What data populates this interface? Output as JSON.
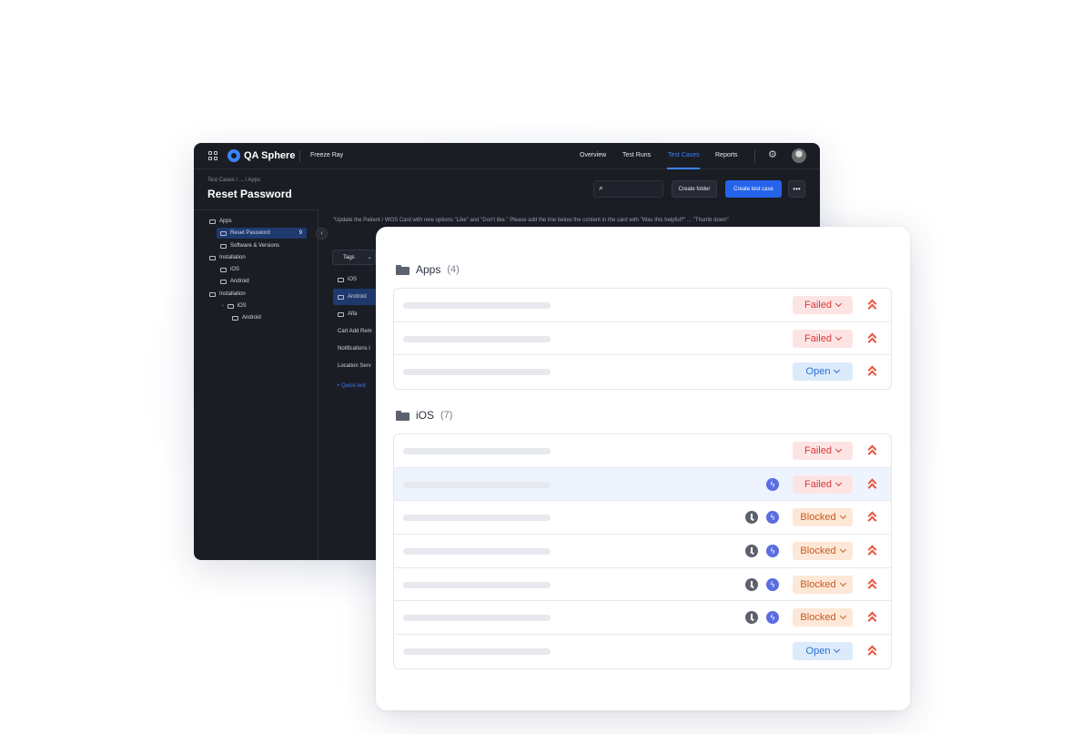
{
  "app": {
    "logo_text": "QA Sphere",
    "project": "Freeze Ray",
    "nav": [
      "Overview",
      "Test Runs",
      "Test Cases",
      "Reports"
    ],
    "active_nav": "Test Cases",
    "accent": "#3b82f6"
  },
  "header": {
    "breadcrumb": "Test Cases   /   ...   /   Apps",
    "title": "Reset Password",
    "search_placeholder": "",
    "create_folder": "Create folder",
    "create_test_case": "Create test case",
    "more": "•••"
  },
  "tree": {
    "items": [
      {
        "label": "Apps"
      },
      {
        "label": "Reset Password",
        "count": "9"
      },
      {
        "label": "Software & Versions"
      },
      {
        "label": "Installation"
      },
      {
        "label": "iOS"
      },
      {
        "label": "Android"
      },
      {
        "label": "Installation"
      },
      {
        "label": "iOS"
      },
      {
        "label": "Android"
      }
    ]
  },
  "middle": {
    "notice": "\"Update the Patient / WOS Card with new options \"Like\" and \"Don't like.\" Please add the line below the content in the card with \"Was this helpful?\" ... \"Thumb down\"",
    "tags_label": "Tags",
    "items": [
      "iOS",
      "Android",
      "Alfa",
      "Cart Add Rem",
      "Notifications l",
      "Location Serv"
    ],
    "quick_add": "+  Quick test"
  },
  "groups": [
    {
      "name": "Apps",
      "count": "(4)",
      "rows": [
        {
          "status": "Failed",
          "kind": "failed",
          "icons": []
        },
        {
          "status": "Failed",
          "kind": "failed",
          "icons": []
        },
        {
          "status": "Open",
          "kind": "open",
          "icons": []
        }
      ]
    },
    {
      "name": "iOS",
      "count": "(7)",
      "rows": [
        {
          "status": "Failed",
          "kind": "failed",
          "icons": []
        },
        {
          "status": "Failed",
          "kind": "failed",
          "icons": [
            "bolt"
          ],
          "highlighted": true
        },
        {
          "status": "Blocked",
          "kind": "blocked",
          "icons": [
            "clock",
            "bolt"
          ]
        },
        {
          "status": "Blocked",
          "kind": "blocked",
          "icons": [
            "clock",
            "bolt"
          ]
        },
        {
          "status": "Blocked",
          "kind": "blocked",
          "icons": [
            "clock",
            "bolt"
          ]
        },
        {
          "status": "Blocked",
          "kind": "blocked",
          "icons": [
            "clock",
            "bolt"
          ]
        },
        {
          "status": "Open",
          "kind": "open",
          "icons": []
        }
      ]
    }
  ],
  "colors": {
    "failed": "#d63a3a",
    "open": "#2b6fd6",
    "blocked": "#c95a1d",
    "priority": "#e8553e"
  }
}
